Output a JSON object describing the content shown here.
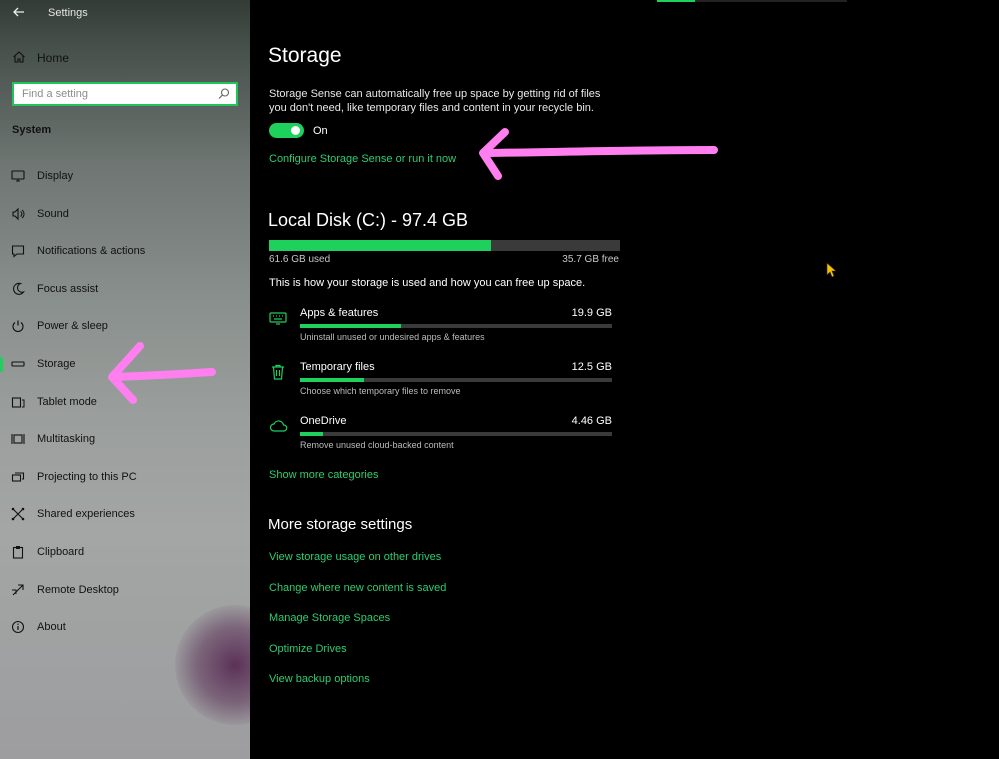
{
  "window": {
    "title": "Settings"
  },
  "sidebar": {
    "home_label": "Home",
    "search": {
      "placeholder": "Find a setting",
      "value": ""
    },
    "section_title": "System",
    "items": [
      {
        "label": "Display",
        "icon": "monitor-icon"
      },
      {
        "label": "Sound",
        "icon": "speaker-icon"
      },
      {
        "label": "Notifications & actions",
        "icon": "message-icon"
      },
      {
        "label": "Focus assist",
        "icon": "moon-icon"
      },
      {
        "label": "Power & sleep",
        "icon": "power-icon"
      },
      {
        "label": "Storage",
        "icon": "drive-icon",
        "selected": true
      },
      {
        "label": "Tablet mode",
        "icon": "tablet-icon"
      },
      {
        "label": "Multitasking",
        "icon": "multitask-icon"
      },
      {
        "label": "Projecting to this PC",
        "icon": "project-icon"
      },
      {
        "label": "Shared experiences",
        "icon": "share-icon"
      },
      {
        "label": "Clipboard",
        "icon": "clipboard-icon"
      },
      {
        "label": "Remote Desktop",
        "icon": "remote-icon"
      },
      {
        "label": "About",
        "icon": "info-icon"
      }
    ]
  },
  "main": {
    "title": "Storage",
    "storage_sense": {
      "description": "Storage Sense can automatically free up space by getting rid of files you don't need, like temporary files and content in your recycle bin.",
      "toggle_state": "On",
      "configure_link": "Configure Storage Sense or run it now"
    },
    "disk": {
      "title": "Local Disk (C:) - 97.4 GB",
      "used": "61.6 GB used",
      "free": "35.7 GB free",
      "used_fraction": 0.632
    },
    "usage_intro": "This is how your storage is used and how you can free up space.",
    "categories": [
      {
        "name": "Apps & features",
        "size": "19.9 GB",
        "subtitle": "Uninstall unused or undesired apps & features",
        "fraction": 0.325,
        "icon": "keyboard-icon"
      },
      {
        "name": "Temporary files",
        "size": "12.5 GB",
        "subtitle": "Choose which temporary files to remove",
        "fraction": 0.205,
        "icon": "trash-icon"
      },
      {
        "name": "OneDrive",
        "size": "4.46 GB",
        "subtitle": "Remove unused cloud-backed content",
        "fraction": 0.075,
        "icon": "cloud-icon"
      }
    ],
    "show_more": "Show more categories",
    "more_settings": {
      "heading": "More storage settings",
      "links": [
        "View storage usage on other drives",
        "Change where new content is saved",
        "Manage Storage Spaces",
        "Optimize Drives",
        "View backup options"
      ]
    }
  },
  "colors": {
    "accent": "#1ed05c",
    "link": "#2ecc71",
    "annotation": "#ff7ff0"
  }
}
